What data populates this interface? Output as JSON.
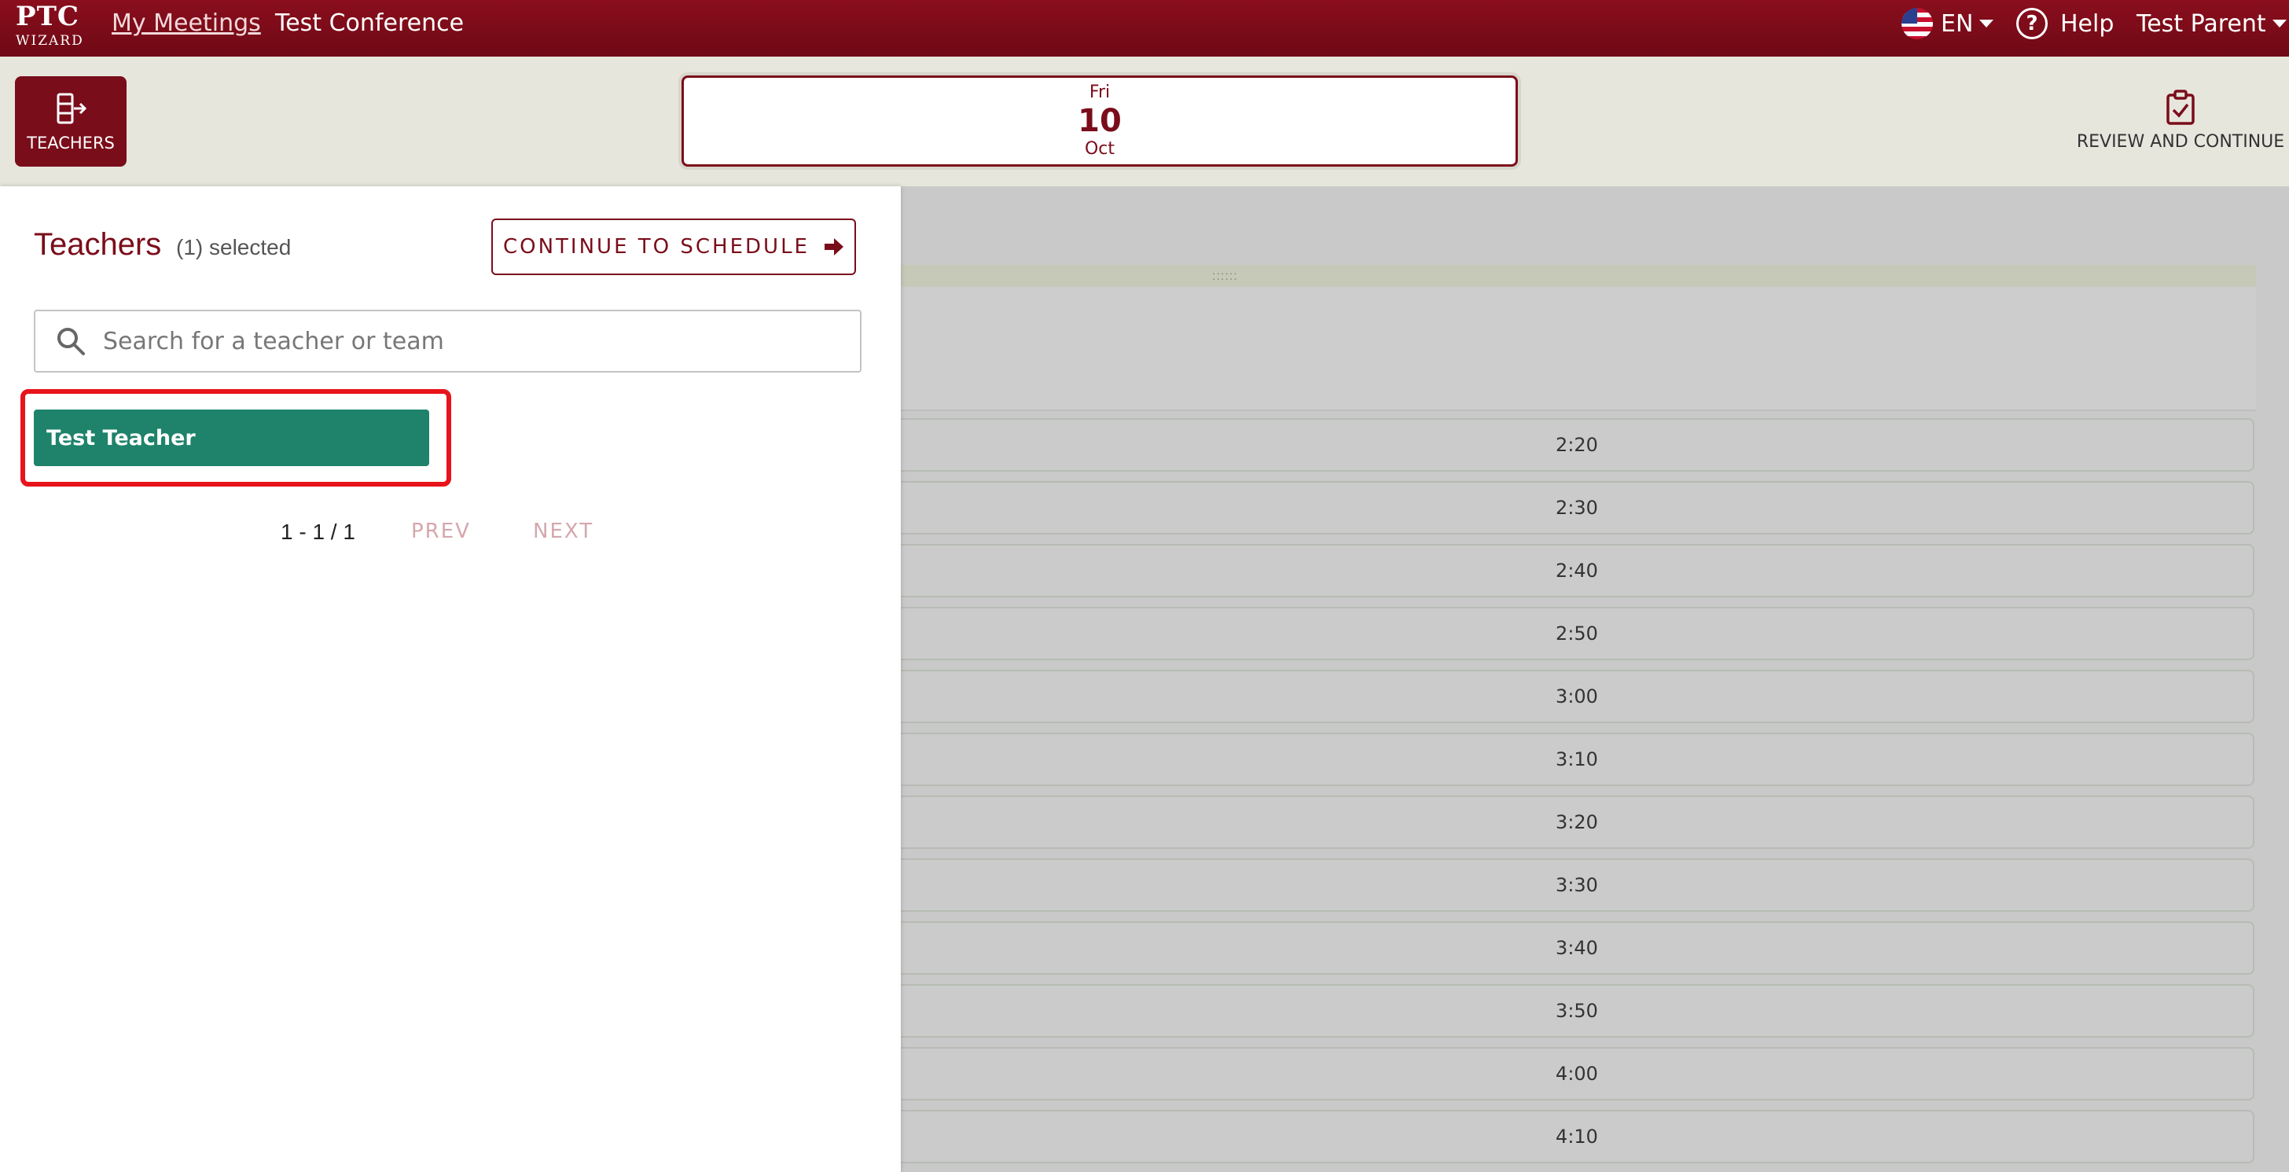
{
  "app": {
    "logo_text": "PTC",
    "logo_subtext": "WIZARD"
  },
  "topnav": {
    "my_meetings": "My Meetings",
    "conference": "Test Conference",
    "language": "EN",
    "help": "Help",
    "user": "Test Parent",
    "help_glyph": "?"
  },
  "toolbar": {
    "teachers_label": "TEACHERS",
    "date": {
      "day_of_week": "Fri",
      "day": "10",
      "month": "Oct"
    },
    "review_label": "REVIEW AND CONTINUE"
  },
  "panel": {
    "title": "Teachers",
    "selected_count": "(1) selected",
    "continue_label": "CONTINUE TO SCHEDULE",
    "search_placeholder": "Search for a teacher or team",
    "teachers": [
      {
        "name": "Test Teacher"
      }
    ],
    "pagination": {
      "range": "1 - 1 / 1",
      "prev": "PREV",
      "next": "NEXT"
    }
  },
  "schedule": {
    "grip": "::::::",
    "slots": [
      "2:20",
      "2:30",
      "2:40",
      "2:50",
      "3:00",
      "3:10",
      "3:20",
      "3:30",
      "3:40",
      "3:50",
      "4:00",
      "4:10"
    ]
  },
  "icons": {
    "teachers": "door-exit-icon",
    "review": "clipboard-check-icon",
    "search": "search-icon",
    "continue": "arrow-right-icon",
    "language": "us-flag-icon",
    "help": "question-circle-icon"
  },
  "colors": {
    "brand": "#7a0d1a",
    "teacher_selected": "#1e836a",
    "highlight": "#e8141c"
  }
}
